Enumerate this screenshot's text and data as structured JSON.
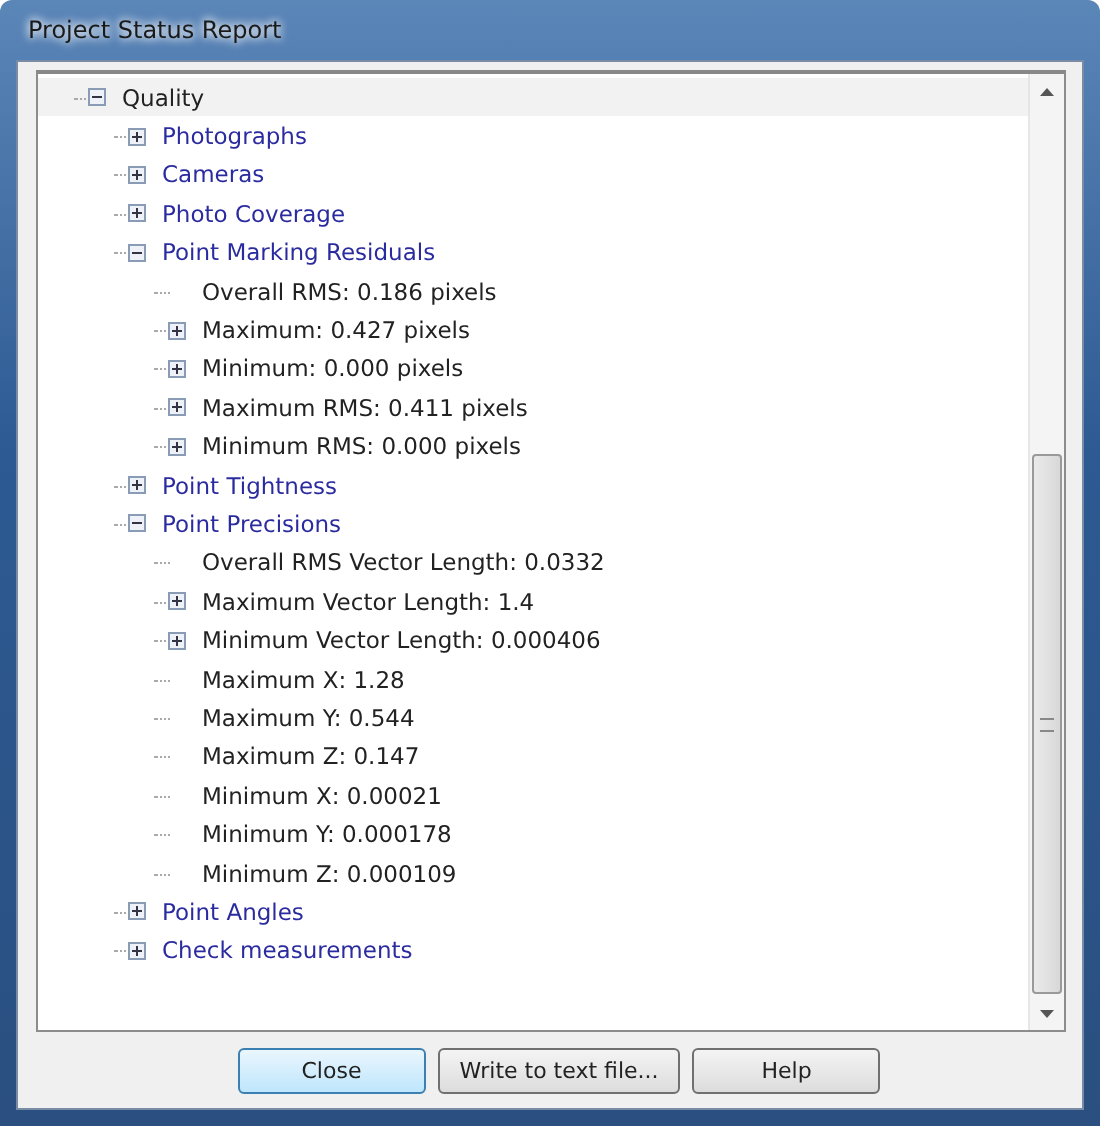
{
  "window": {
    "title": "Project Status Report"
  },
  "tree": [
    {
      "label": "Quality",
      "kind": "branch",
      "expanded": true,
      "children": [
        {
          "label": "Photographs",
          "kind": "branch",
          "expanded": false
        },
        {
          "label": "Cameras",
          "kind": "branch",
          "expanded": false
        },
        {
          "label": "Photo Coverage",
          "kind": "branch",
          "expanded": false
        },
        {
          "label": "Point Marking Residuals",
          "kind": "branch",
          "expanded": true,
          "children": [
            {
              "label": "Overall RMS: 0.186 pixels",
              "kind": "leaf"
            },
            {
              "label": "Maximum: 0.427 pixels",
              "kind": "branch",
              "expanded": false
            },
            {
              "label": "Minimum: 0.000 pixels",
              "kind": "branch",
              "expanded": false
            },
            {
              "label": "Maximum RMS: 0.411 pixels",
              "kind": "branch",
              "expanded": false
            },
            {
              "label": "Minimum RMS: 0.000 pixels",
              "kind": "branch",
              "expanded": false
            }
          ]
        },
        {
          "label": "Point Tightness",
          "kind": "branch",
          "expanded": false
        },
        {
          "label": "Point Precisions",
          "kind": "branch",
          "expanded": true,
          "children": [
            {
              "label": "Overall RMS Vector Length: 0.0332",
              "kind": "leaf"
            },
            {
              "label": "Maximum Vector Length: 1.4",
              "kind": "branch",
              "expanded": false
            },
            {
              "label": "Minimum Vector Length: 0.000406",
              "kind": "branch",
              "expanded": false
            },
            {
              "label": "Maximum X: 1.28",
              "kind": "leaf"
            },
            {
              "label": "Maximum Y: 0.544",
              "kind": "leaf"
            },
            {
              "label": "Maximum Z: 0.147",
              "kind": "leaf"
            },
            {
              "label": "Minimum X: 0.00021",
              "kind": "leaf"
            },
            {
              "label": "Minimum Y: 0.000178",
              "kind": "leaf"
            },
            {
              "label": "Minimum Z: 0.000109",
              "kind": "leaf"
            }
          ]
        },
        {
          "label": "Point Angles",
          "kind": "branch",
          "expanded": false
        },
        {
          "label": "Check measurements",
          "kind": "branch",
          "expanded": false
        }
      ]
    }
  ],
  "buttons": [
    {
      "label": "Close",
      "focused": true
    },
    {
      "label": "Write to text file...",
      "focused": false
    },
    {
      "label": "Help",
      "focused": false
    }
  ]
}
